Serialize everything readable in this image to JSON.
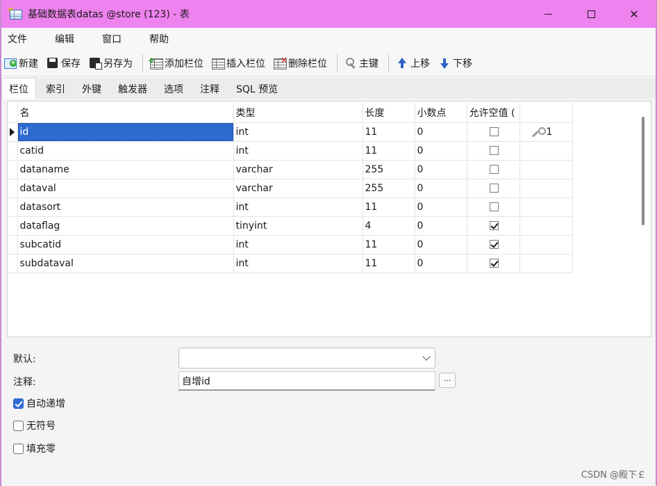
{
  "window": {
    "title": "基础数据表datas @store (123) - 表",
    "minimize_label": "",
    "maximize_label": "",
    "close_label": "✕"
  },
  "menu": [
    "文件",
    "编辑",
    "窗口",
    "帮助"
  ],
  "toolbar": {
    "new": "新建",
    "save": "保存",
    "save_as": "另存为",
    "add_column": "添加栏位",
    "insert_column": "插入栏位",
    "delete_column": "删除栏位",
    "primary_key": "主键",
    "move_up": "上移",
    "move_down": "下移"
  },
  "tabs": [
    "栏位",
    "索引",
    "外键",
    "触发器",
    "选项",
    "注释",
    "SQL 预览"
  ],
  "active_tab": "栏位",
  "grid": {
    "headers": [
      "名",
      "类型",
      "长度",
      "小数点",
      "允许空值 (",
      ""
    ],
    "rows": [
      {
        "name": "id",
        "type": "int",
        "length": "11",
        "decimals": "0",
        "nullable": false,
        "key": "1",
        "selected": true
      },
      {
        "name": "catid",
        "type": "int",
        "length": "11",
        "decimals": "0",
        "nullable": false,
        "key": ""
      },
      {
        "name": "dataname",
        "type": "varchar",
        "length": "255",
        "decimals": "0",
        "nullable": false,
        "key": ""
      },
      {
        "name": "dataval",
        "type": "varchar",
        "length": "255",
        "decimals": "0",
        "nullable": false,
        "key": ""
      },
      {
        "name": "datasort",
        "type": "int",
        "length": "11",
        "decimals": "0",
        "nullable": false,
        "key": ""
      },
      {
        "name": "dataflag",
        "type": "tinyint",
        "length": "4",
        "decimals": "0",
        "nullable": true,
        "key": ""
      },
      {
        "name": "subcatid",
        "type": "int",
        "length": "11",
        "decimals": "0",
        "nullable": true,
        "key": ""
      },
      {
        "name": "subdataval",
        "type": "int",
        "length": "11",
        "decimals": "0",
        "nullable": true,
        "key": ""
      }
    ]
  },
  "properties": {
    "default_label": "默认:",
    "default_value": "",
    "comment_label": "注释:",
    "comment_value": "自增id",
    "more_label": "...",
    "auto_increment_label": "自动递增",
    "auto_increment": true,
    "unsigned_label": "无符号",
    "unsigned": false,
    "zerofill_label": "填充零",
    "zerofill": false
  },
  "watermark": "CSDN @殿下￡",
  "colors": {
    "titlebar": "#ee82ee",
    "selection": "#2e6bd1"
  }
}
